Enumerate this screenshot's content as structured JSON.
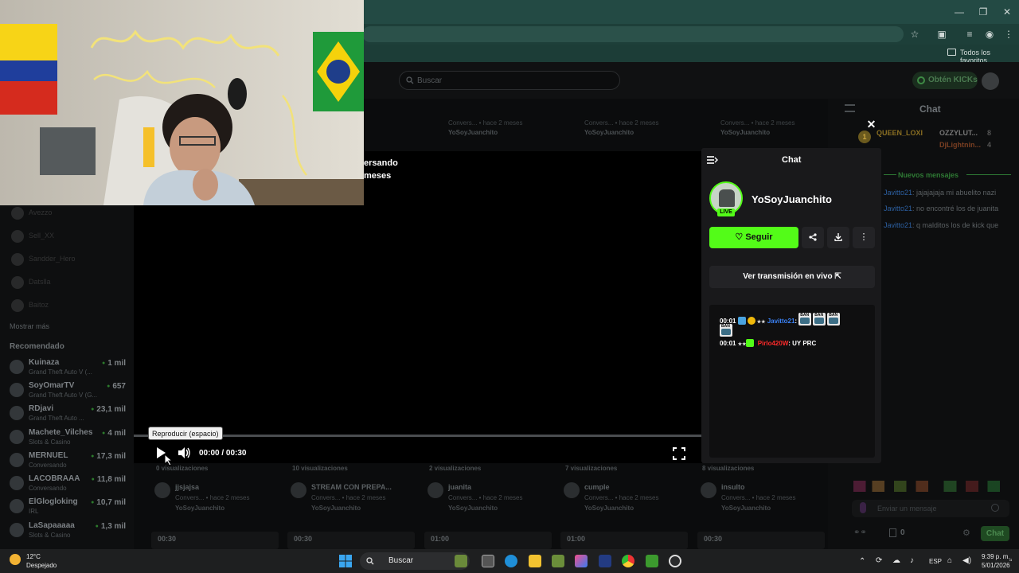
{
  "browser": {
    "favorites_label": "Todos los favoritos",
    "window_controls": [
      "—",
      "❐",
      "✕"
    ]
  },
  "header": {
    "search_placeholder": "Buscar",
    "kicks_label": "Obtén KICKs"
  },
  "sidebar": {
    "show_more": "Mostrar más",
    "recommended_title": "Recomendado",
    "followed_ghosts": [
      "Avezzo",
      "Sell_XX",
      "Sandder_Hero",
      "Datslla",
      "Baitoz"
    ],
    "recommended": [
      {
        "name": "Kuinaza",
        "category": "Grand Theft Auto V (...",
        "viewers": "1 mil"
      },
      {
        "name": "SoyOmarTV",
        "category": "Grand Theft Auto V (G...",
        "viewers": "657"
      },
      {
        "name": "RDjavi",
        "category": "Grand Theft Auto ...",
        "viewers": "23,1 mil"
      },
      {
        "name": "Machete_Vilches",
        "category": "Slots & Casino",
        "viewers": "4 mil"
      },
      {
        "name": "MERNUEL",
        "category": "Conversando",
        "viewers": "17,3 mil"
      },
      {
        "name": "LACOBRAAA",
        "category": "Conversando",
        "viewers": "11,8 mil"
      },
      {
        "name": "ElGlogloking",
        "category": "IRL",
        "viewers": "10,7 mil"
      },
      {
        "name": "LaSapaaaaa",
        "category": "Slots & Casino",
        "viewers": "1,3 mil"
      }
    ]
  },
  "grid": {
    "top_row": [
      {
        "meta": "Convers... • hace 2 meses",
        "by": "YoSoyJuanchito"
      },
      {
        "meta": "Convers... • hace 2 meses",
        "by": "YoSoyJuanchito"
      },
      {
        "meta": "Convers... • hace 2 meses",
        "by": "YoSoyJuanchito"
      },
      {
        "meta": "Convers... • hace 2 meses",
        "by": "YoSoyJuanchito"
      }
    ],
    "cards": [
      {
        "views": "0 visualizaciones",
        "title": "jjsjajsa",
        "meta": "Convers... • hace 2 meses",
        "by": "YoSoyJuanchito",
        "duration": "00:30"
      },
      {
        "views": "10 visualizaciones",
        "title": "STREAM CON PREPA...",
        "meta": "Convers... • hace 2 meses",
        "by": "YoSoyJuanchito",
        "duration": "00:30"
      },
      {
        "views": "2 visualizaciones",
        "title": "juanita",
        "meta": "Convers... • hace 2 meses",
        "by": "YoSoyJuanchito",
        "duration": "01:00"
      },
      {
        "views": "7 visualizaciones",
        "title": "cumple",
        "meta": "Convers... • hace 2 meses",
        "by": "YoSoyJuanchito",
        "duration": "01:00"
      },
      {
        "views": "8 visualizaciones",
        "title": "insulto",
        "meta": "Convers... • hace 2 meses",
        "by": "YoSoyJuanchito",
        "duration": "00:30"
      }
    ],
    "title_fragment_1": "ersando",
    "title_fragment_2": "meses"
  },
  "player": {
    "time": "00:00 / 00:30",
    "tooltip": "Reproducir (espacio)",
    "progress": 0
  },
  "panel": {
    "title": "Chat",
    "channel_name": "YoSoyJuanchito",
    "live_badge": "LIVE",
    "follow_label": "Seguir",
    "live_link": "Ver transmisión en vivo",
    "messages": [
      {
        "time": "00:01",
        "user": "Javitto21",
        "user_color": "#3b82f6",
        "text": ":"
      },
      {
        "time": "00:01",
        "user": "Pirlo420W",
        "user_color": "#ff2a2a",
        "text": ": UY PRC"
      }
    ]
  },
  "right_chat": {
    "title": "Chat",
    "top_users": [
      {
        "name": "QUEEN_LOXI",
        "color": "#b8860b"
      },
      {
        "name": "OZZYLUT...",
        "count": "8",
        "color": "#9a9a9a"
      },
      {
        "name": "DjLightnin...",
        "count": "4",
        "color": "#a0522d"
      }
    ],
    "new_messages": "Nuevos mensajes",
    "messages": [
      {
        "user": "Javitto21",
        "text": ": jajajajaja mi abuelito nazi"
      },
      {
        "user": "Javitto21",
        "text": ": no encontré los de juanita"
      },
      {
        "user": "Javitto21",
        "text": ": q malditos los de kick que"
      }
    ],
    "input_placeholder": "Enviar un mensaje",
    "send_label": "Chat",
    "count": "0"
  },
  "taskbar": {
    "weather_temp": "12°C",
    "weather_desc": "Despejado",
    "search_label": "Buscar",
    "language": "ESP",
    "time": "9:39 p. m.",
    "date": "5/01/2026"
  }
}
